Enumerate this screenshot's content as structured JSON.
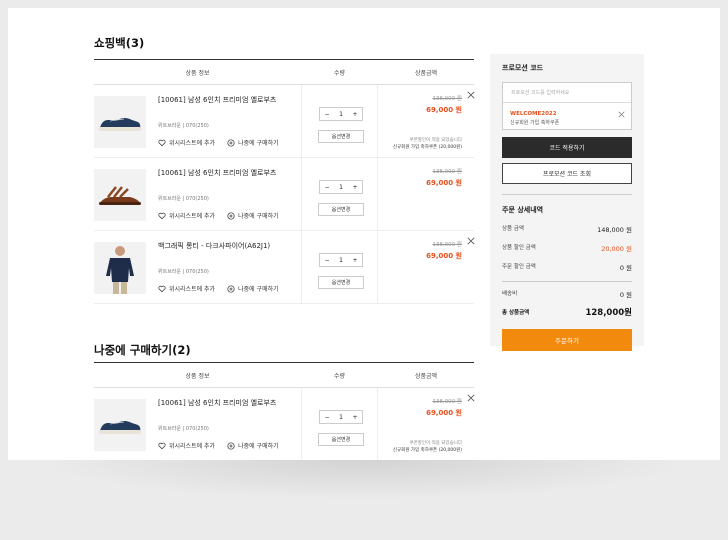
{
  "cart": {
    "title": "쇼핑백(3)",
    "headers": {
      "info": "상품 정보",
      "qty": "수량",
      "price": "상품금액"
    },
    "items": [
      {
        "name": "[10061] 남성 6인치 프리미엄 옐로부츠",
        "option": "위트브라운 | 070(250)",
        "qty": "1",
        "option_button": "옵션변경",
        "old_price": "138,000 원",
        "price": "69,000 원",
        "note1": "쿠폰할인이 적용 되었습니다",
        "note2": "신규회원 가입 축하쿠폰 (20,000원)",
        "wishlist": "위시리스트에 추가",
        "later": "나중에 구매하기"
      },
      {
        "name": "[10061] 남성 6인치 프리미엄 옐로부츠",
        "option": "위트브라운 | 070(250)",
        "qty": "1",
        "option_button": "옵션변경",
        "old_price": "138,000 원",
        "price": "69,000 원",
        "wishlist": "위시리스트에 추가",
        "later": "나중에 구매하기"
      },
      {
        "name": "백그래픽 롱티 - 다크사파이어(A62J1)",
        "option": "위트브라운 | 070(250)",
        "qty": "1",
        "option_button": "옵션변경",
        "old_price": "138,000 원",
        "price": "69,000 원",
        "wishlist": "위시리스트에 추가",
        "later": "나중에 구매하기"
      }
    ]
  },
  "later": {
    "title": "나중에 구매하기(2)",
    "headers": {
      "info": "상품 정보",
      "qty": "수량",
      "price": "상품금액"
    },
    "items": [
      {
        "name": "[10061] 남성 6인치 프리미엄 옐로부츠",
        "option": "위트브라운 | 070(250)",
        "qty": "1",
        "option_button": "옵션변경",
        "old_price": "138,000 원",
        "price": "69,000 원",
        "note1": "쿠폰할인이 적용 되었습니다",
        "note2": "신규회원 가입 축하쿠폰 (20,000원)",
        "wishlist": "위시리스트에 추가",
        "later": "나중에 구매하기"
      }
    ]
  },
  "side": {
    "promo_title": "프로모션 코드",
    "promo_placeholder": "프로모션 코드를 입력하세요",
    "coupon_code": "WELCOME2022",
    "coupon_desc": "신규회원 가입 축하쿠폰",
    "apply_button": "코드 적용하기",
    "lookup_button": "프로모션 코드 조회",
    "summary_title": "주문 상세내역",
    "rows": [
      {
        "label": "상품 금액",
        "value": "148,000 원"
      },
      {
        "label": "상품 할인 금액",
        "value": "20,000 원"
      },
      {
        "label": "주문 할인 금액",
        "value": "0 원"
      }
    ],
    "shipping_label": "배송비",
    "shipping_value": "0 원",
    "total_label": "총 상품금액",
    "total_value": "128,000원",
    "order_button": "주문하기"
  },
  "colors": {
    "accent": "#e8501d",
    "order": "#f28a0e",
    "dark": "#2b2b2b"
  }
}
